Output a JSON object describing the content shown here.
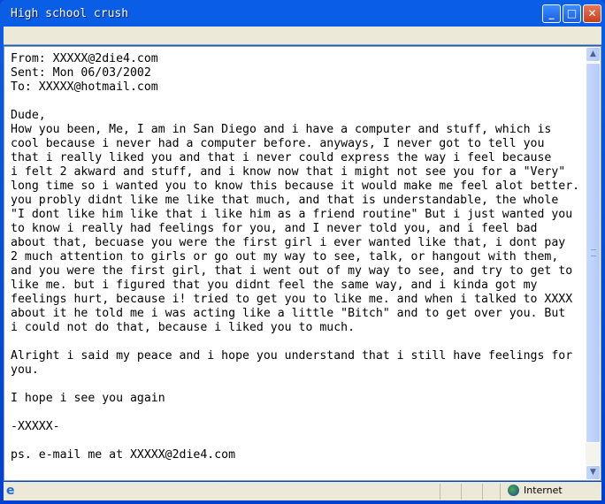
{
  "window": {
    "title": "High school crush"
  },
  "email": {
    "headers": [
      "From: XXXXX@2die4.com",
      "Sent: Mon 06/03/2002",
      "To: XXXXX@hotmail.com"
    ],
    "body": [
      "",
      "Dude,",
      "How you been, Me, I am in San Diego and i have a computer and stuff, which is",
      "cool because i never had a computer before. anyways, I never got to tell you",
      "that i really liked you and that i never could express the way i feel because",
      "i felt 2 akward and stuff, and i know now that i might not see you for a \"Very\"",
      "long time so i wanted you to know this because it would make me feel alot better.",
      "you probly didnt like me like that much, and that is understandable, the whole",
      "\"I dont like him like that i like him as a friend routine\" But i just wanted you",
      "to know i really had feelings for you, and I never told you, and i feel bad",
      "about that, becuase you were the first girl i ever wanted like that, i dont pay",
      "2 much attention to girls or go out my way to see, talk, or hangout with them,",
      "and you were the first girl, that i went out of my way to see, and try to get to",
      "like me. but i figured that you didnt feel the same way, and i kinda got my",
      "feelings hurt, because i! tried to get you to like me. and when i talked to XXXX",
      "about it he told me i was acting like a little \"Bitch\" and to get over you. But",
      "i could not do that, because i liked you to much.",
      "",
      "Alright i said my peace and i hope you understand that i still have feelings for",
      "you.",
      "",
      "I hope i see you again",
      "",
      "-XXXXX-",
      "",
      "ps. e-mail me at XXXXX@2die4.com"
    ]
  },
  "status": {
    "zone": "Internet",
    "zone_icon": "globe-icon",
    "page_icon": "ie-page-icon"
  }
}
